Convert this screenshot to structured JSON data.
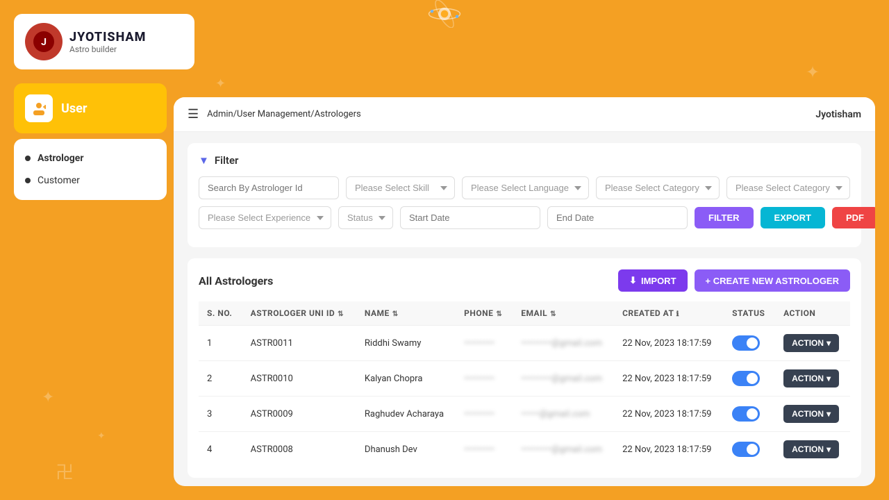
{
  "app": {
    "name": "JYOTISHAM",
    "tagline": "Astro builder",
    "user": "Jyotisham"
  },
  "breadcrumb": "Admin/User Management/Astrologers",
  "sidebar": {
    "section_label": "User",
    "nav_items": [
      {
        "label": "Astrologer",
        "active": true
      },
      {
        "label": "Customer",
        "active": false
      }
    ]
  },
  "filter": {
    "title": "Filter",
    "search_placeholder": "Search By Astrologer Id",
    "skill_placeholder": "Please Select Skill",
    "language_placeholder": "Please Select Language",
    "category1_placeholder": "Please Select Category",
    "category2_placeholder": "Please Select Category",
    "experience_placeholder": "Please Select Experience",
    "status_placeholder": "Status",
    "start_date_placeholder": "Start Date",
    "end_date_placeholder": "End Date",
    "filter_btn": "FILTER",
    "export_btn": "EXPORT",
    "pdf_btn": "PDF"
  },
  "table": {
    "title": "All Astrologers",
    "import_btn": "IMPORT",
    "create_btn": "+ CREATE NEW ASTROLOGER",
    "columns": [
      "S. NO.",
      "ASTROLOGER UNI ID",
      "NAME",
      "PHONE",
      "EMAIL",
      "CREATED AT",
      "STATUS",
      "ACTION"
    ],
    "rows": [
      {
        "sno": "1",
        "id": "ASTR0011",
        "name": "Riddhi Swamy",
        "phone": "••••••••••",
        "email": "••••••••••@gmail.com",
        "created": "22 Nov, 2023 18:17:59",
        "status": true,
        "action": "ACTION"
      },
      {
        "sno": "2",
        "id": "ASTR0010",
        "name": "Kalyan Chopra",
        "phone": "••••••••••",
        "email": "••••••••••@gmail.com",
        "created": "22 Nov, 2023 18:17:59",
        "status": true,
        "action": "ACTION"
      },
      {
        "sno": "3",
        "id": "ASTR0009",
        "name": "Raghudev Acharaya",
        "phone": "••••••••••",
        "email": "••••••@gmail.com",
        "created": "22 Nov, 2023 18:17:59",
        "status": true,
        "action": "ACTION"
      },
      {
        "sno": "4",
        "id": "ASTR0008",
        "name": "Dhanush Dev",
        "phone": "••••••••••",
        "email": "••••••••••@gmail.com",
        "created": "22 Nov, 2023 18:17:59",
        "status": true,
        "action": "ACTION"
      }
    ]
  }
}
